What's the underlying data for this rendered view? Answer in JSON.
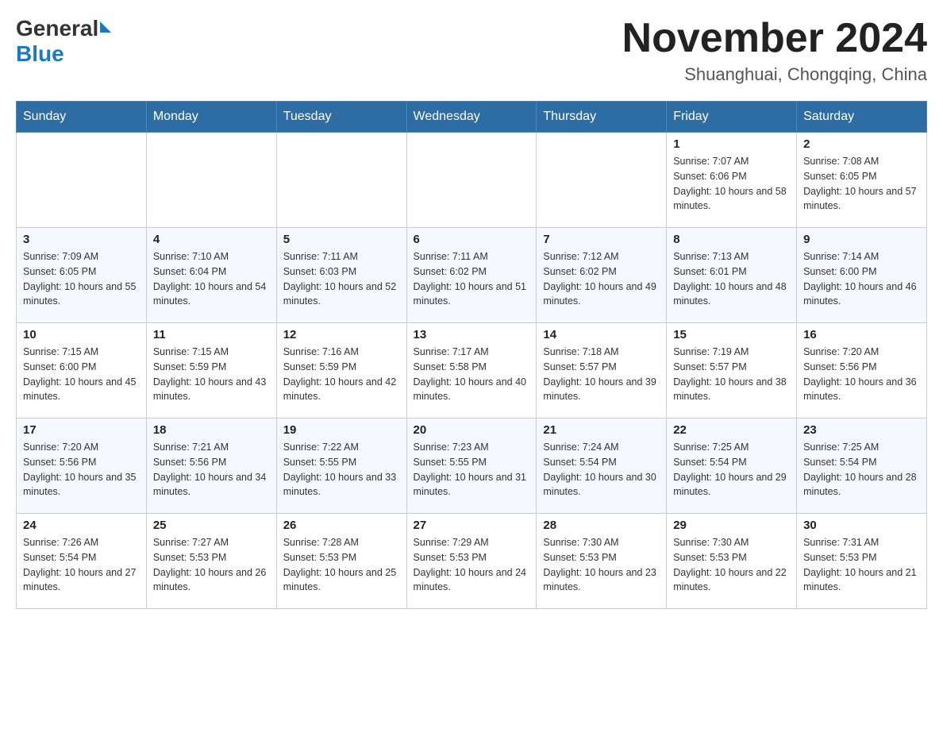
{
  "logo": {
    "general": "General",
    "blue": "Blue"
  },
  "title": "November 2024",
  "location": "Shuanghuai, Chongqing, China",
  "days_of_week": [
    "Sunday",
    "Monday",
    "Tuesday",
    "Wednesday",
    "Thursday",
    "Friday",
    "Saturday"
  ],
  "weeks": [
    [
      {
        "day": "",
        "info": ""
      },
      {
        "day": "",
        "info": ""
      },
      {
        "day": "",
        "info": ""
      },
      {
        "day": "",
        "info": ""
      },
      {
        "day": "",
        "info": ""
      },
      {
        "day": "1",
        "info": "Sunrise: 7:07 AM\nSunset: 6:06 PM\nDaylight: 10 hours and 58 minutes."
      },
      {
        "day": "2",
        "info": "Sunrise: 7:08 AM\nSunset: 6:05 PM\nDaylight: 10 hours and 57 minutes."
      }
    ],
    [
      {
        "day": "3",
        "info": "Sunrise: 7:09 AM\nSunset: 6:05 PM\nDaylight: 10 hours and 55 minutes."
      },
      {
        "day": "4",
        "info": "Sunrise: 7:10 AM\nSunset: 6:04 PM\nDaylight: 10 hours and 54 minutes."
      },
      {
        "day": "5",
        "info": "Sunrise: 7:11 AM\nSunset: 6:03 PM\nDaylight: 10 hours and 52 minutes."
      },
      {
        "day": "6",
        "info": "Sunrise: 7:11 AM\nSunset: 6:02 PM\nDaylight: 10 hours and 51 minutes."
      },
      {
        "day": "7",
        "info": "Sunrise: 7:12 AM\nSunset: 6:02 PM\nDaylight: 10 hours and 49 minutes."
      },
      {
        "day": "8",
        "info": "Sunrise: 7:13 AM\nSunset: 6:01 PM\nDaylight: 10 hours and 48 minutes."
      },
      {
        "day": "9",
        "info": "Sunrise: 7:14 AM\nSunset: 6:00 PM\nDaylight: 10 hours and 46 minutes."
      }
    ],
    [
      {
        "day": "10",
        "info": "Sunrise: 7:15 AM\nSunset: 6:00 PM\nDaylight: 10 hours and 45 minutes."
      },
      {
        "day": "11",
        "info": "Sunrise: 7:15 AM\nSunset: 5:59 PM\nDaylight: 10 hours and 43 minutes."
      },
      {
        "day": "12",
        "info": "Sunrise: 7:16 AM\nSunset: 5:59 PM\nDaylight: 10 hours and 42 minutes."
      },
      {
        "day": "13",
        "info": "Sunrise: 7:17 AM\nSunset: 5:58 PM\nDaylight: 10 hours and 40 minutes."
      },
      {
        "day": "14",
        "info": "Sunrise: 7:18 AM\nSunset: 5:57 PM\nDaylight: 10 hours and 39 minutes."
      },
      {
        "day": "15",
        "info": "Sunrise: 7:19 AM\nSunset: 5:57 PM\nDaylight: 10 hours and 38 minutes."
      },
      {
        "day": "16",
        "info": "Sunrise: 7:20 AM\nSunset: 5:56 PM\nDaylight: 10 hours and 36 minutes."
      }
    ],
    [
      {
        "day": "17",
        "info": "Sunrise: 7:20 AM\nSunset: 5:56 PM\nDaylight: 10 hours and 35 minutes."
      },
      {
        "day": "18",
        "info": "Sunrise: 7:21 AM\nSunset: 5:56 PM\nDaylight: 10 hours and 34 minutes."
      },
      {
        "day": "19",
        "info": "Sunrise: 7:22 AM\nSunset: 5:55 PM\nDaylight: 10 hours and 33 minutes."
      },
      {
        "day": "20",
        "info": "Sunrise: 7:23 AM\nSunset: 5:55 PM\nDaylight: 10 hours and 31 minutes."
      },
      {
        "day": "21",
        "info": "Sunrise: 7:24 AM\nSunset: 5:54 PM\nDaylight: 10 hours and 30 minutes."
      },
      {
        "day": "22",
        "info": "Sunrise: 7:25 AM\nSunset: 5:54 PM\nDaylight: 10 hours and 29 minutes."
      },
      {
        "day": "23",
        "info": "Sunrise: 7:25 AM\nSunset: 5:54 PM\nDaylight: 10 hours and 28 minutes."
      }
    ],
    [
      {
        "day": "24",
        "info": "Sunrise: 7:26 AM\nSunset: 5:54 PM\nDaylight: 10 hours and 27 minutes."
      },
      {
        "day": "25",
        "info": "Sunrise: 7:27 AM\nSunset: 5:53 PM\nDaylight: 10 hours and 26 minutes."
      },
      {
        "day": "26",
        "info": "Sunrise: 7:28 AM\nSunset: 5:53 PM\nDaylight: 10 hours and 25 minutes."
      },
      {
        "day": "27",
        "info": "Sunrise: 7:29 AM\nSunset: 5:53 PM\nDaylight: 10 hours and 24 minutes."
      },
      {
        "day": "28",
        "info": "Sunrise: 7:30 AM\nSunset: 5:53 PM\nDaylight: 10 hours and 23 minutes."
      },
      {
        "day": "29",
        "info": "Sunrise: 7:30 AM\nSunset: 5:53 PM\nDaylight: 10 hours and 22 minutes."
      },
      {
        "day": "30",
        "info": "Sunrise: 7:31 AM\nSunset: 5:53 PM\nDaylight: 10 hours and 21 minutes."
      }
    ]
  ],
  "accent_color": "#2e6da4"
}
